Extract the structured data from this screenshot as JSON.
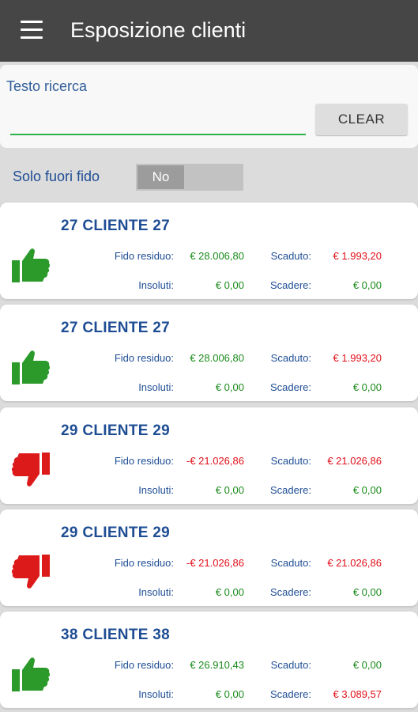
{
  "appbar": {
    "title": "Esposizione clienti",
    "menu_icon": "hamburger-menu-icon",
    "bg_color": "#464646"
  },
  "search": {
    "label": "Testo ricerca",
    "value": "",
    "placeholder": "",
    "clear_label": "CLEAR",
    "underline_color": "#2bb24c"
  },
  "filter": {
    "label": "Solo fuori fido",
    "toggle_value": "No"
  },
  "colors": {
    "positive": "#1a8a1a",
    "negative": "#e0101a",
    "label": "#1e4d94"
  },
  "customers": [
    {
      "name": "27 CLIENTE 27",
      "status": "thumbs-up-icon",
      "fido_label": "Fido residuo:",
      "fido": "€ 28.006,80",
      "fido_neg": false,
      "scaduto_label": "Scaduto:",
      "scaduto": "€ 1.993,20",
      "scaduto_neg": true,
      "insoluti_label": "Insoluti:",
      "insoluti": "€ 0,00",
      "insoluti_neg": false,
      "scadere_label": "Scadere:",
      "scadere": "€ 0,00",
      "scadere_neg": false
    },
    {
      "name": "27 CLIENTE 27",
      "status": "thumbs-up-icon",
      "fido_label": "Fido residuo:",
      "fido": "€ 28.006,80",
      "fido_neg": false,
      "scaduto_label": "Scaduto:",
      "scaduto": "€ 1.993,20",
      "scaduto_neg": true,
      "insoluti_label": "Insoluti:",
      "insoluti": "€ 0,00",
      "insoluti_neg": false,
      "scadere_label": "Scadere:",
      "scadere": "€ 0,00",
      "scadere_neg": false
    },
    {
      "name": "29 CLIENTE 29",
      "status": "thumbs-down-icon",
      "fido_label": "Fido residuo:",
      "fido": "-€ 21.026,86",
      "fido_neg": true,
      "scaduto_label": "Scaduto:",
      "scaduto": "€ 21.026,86",
      "scaduto_neg": true,
      "insoluti_label": "Insoluti:",
      "insoluti": "€ 0,00",
      "insoluti_neg": false,
      "scadere_label": "Scadere:",
      "scadere": "€ 0,00",
      "scadere_neg": false
    },
    {
      "name": "29 CLIENTE 29",
      "status": "thumbs-down-icon",
      "fido_label": "Fido residuo:",
      "fido": "-€ 21.026,86",
      "fido_neg": true,
      "scaduto_label": "Scaduto:",
      "scaduto": "€ 21.026,86",
      "scaduto_neg": true,
      "insoluti_label": "Insoluti:",
      "insoluti": "€ 0,00",
      "insoluti_neg": false,
      "scadere_label": "Scadere:",
      "scadere": "€ 0,00",
      "scadere_neg": false
    },
    {
      "name": "38 CLIENTE 38",
      "status": "thumbs-up-icon",
      "fido_label": "Fido residuo:",
      "fido": "€ 26.910,43",
      "fido_neg": false,
      "scaduto_label": "Scaduto:",
      "scaduto": "€ 0,00",
      "scaduto_neg": false,
      "insoluti_label": "Insoluti:",
      "insoluti": "€ 0,00",
      "insoluti_neg": false,
      "scadere_label": "Scadere:",
      "scadere": "€ 3.089,57",
      "scadere_neg": true
    }
  ]
}
